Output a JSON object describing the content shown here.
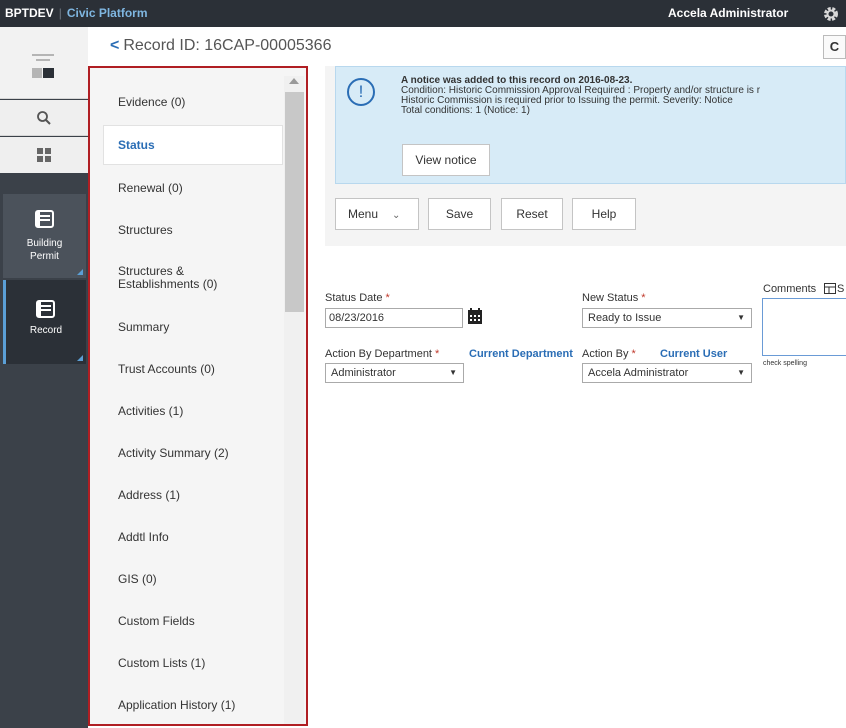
{
  "topbar": {
    "env": "BPTDEV",
    "separator": "|",
    "platform": "Civic Platform",
    "user": "Accela Administrator"
  },
  "leftnav": {
    "tiles": [
      {
        "line1": "Building",
        "line2": "Permit"
      },
      {
        "line1": "Record"
      }
    ]
  },
  "header": {
    "back": "<",
    "title": "Record ID: 16CAP-00005366",
    "refresh": "C"
  },
  "tabs": [
    "Evidence (0)",
    "Status",
    "Renewal (0)",
    "Structures",
    "Structures &",
    "Establishments (0)",
    "Summary",
    "Trust Accounts (0)",
    "Activities (1)",
    "Activity Summary (2)",
    "Address (1)",
    "Addtl Info",
    "GIS (0)",
    "Custom Fields",
    "Custom Lists (1)",
    "Application History (1)"
  ],
  "notice": {
    "icon": "!",
    "line1": "A notice was added to this record on 2016-08-23.",
    "line2": "Condition: Historic Commission Approval Required : Property and/or structure is r",
    "line3": "Historic Commission is required prior to Issuing the permit. Severity: Notice",
    "line4": "Total conditions: 1   (Notice: 1)",
    "button": "View notice"
  },
  "toolbar": {
    "menu": "Menu",
    "save": "Save",
    "reset": "Reset",
    "help": "Help"
  },
  "form": {
    "status_date_label": "Status Date",
    "status_date_value": "08/23/2016",
    "new_status_label": "New Status",
    "new_status_value": "Ready to Issue",
    "comments_label": "Comments",
    "comments_suffix": "S",
    "action_dept_label": "Action By Department",
    "current_dept_link": "Current Department",
    "action_dept_value": "Administrator",
    "action_by_label": "Action By",
    "current_user_link": "Current User",
    "action_by_value": "Accela Administrator",
    "spell": "check spelling",
    "required_mark": "*"
  },
  "colors": {
    "accent": "#2a6db5",
    "highlight_border": "#b01e23",
    "notice_bg": "#d7ebf7",
    "topbar": "#2b3037"
  }
}
